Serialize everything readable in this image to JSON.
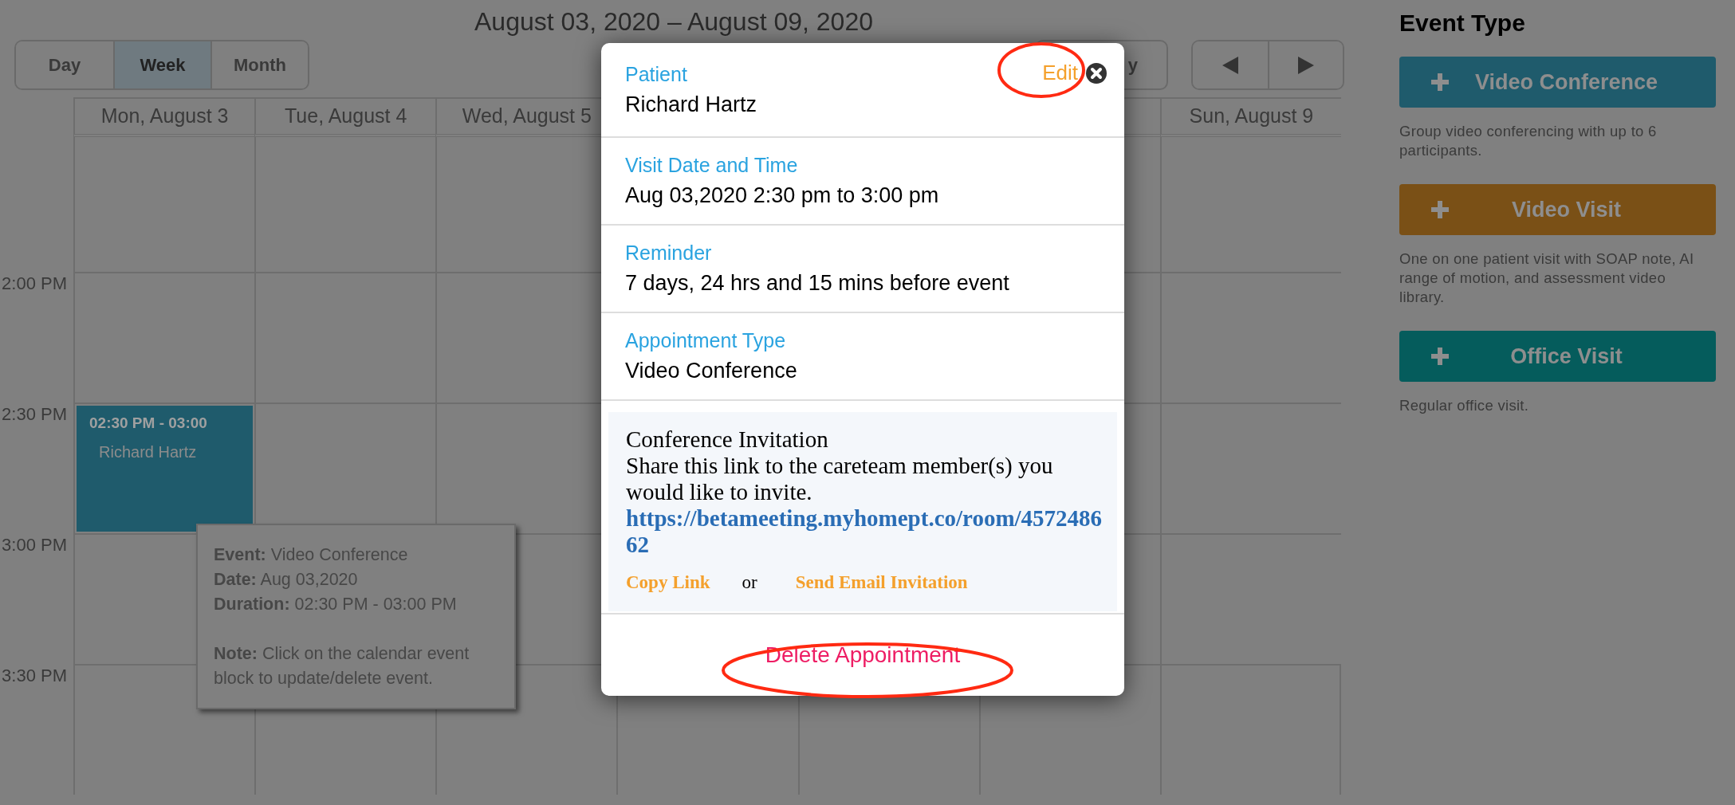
{
  "calendar": {
    "title": "August 03, 2020 – August 09, 2020",
    "views": [
      {
        "label": "Day",
        "selected": false
      },
      {
        "label": "Week",
        "selected": true
      },
      {
        "label": "Month",
        "selected": false
      }
    ],
    "nav_button": {
      "label": "y"
    },
    "day_headers_left": [
      "Mon, August 3",
      "Tue, August 4",
      "Wed, August 5"
    ],
    "day_headers_right": [
      "Sun, August 9"
    ],
    "time_slots": [
      "2:00 PM",
      "2:30 PM",
      "3:00 PM",
      "3:30 PM"
    ],
    "event": {
      "time": "02:30 PM - 03:00",
      "patient": "Richard Hartz"
    },
    "tooltip": {
      "lines": [
        "**Event:** Video Conference",
        "**Date:** Aug 03,2020",
        "**Duration:** 02:30 PM - 03:00 PM"
      ],
      "note": "**Note:** Click on the calendar event block to update/delete event."
    }
  },
  "event_types": {
    "title": "Event Type",
    "items": [
      {
        "label": "Video Conference",
        "description": "Group video conferencing with up to 6 participants.",
        "color": "#1f5b6c"
      },
      {
        "label": "Video Visit",
        "description": "One on one patient visit with SOAP note, AI range of motion, and assessment video library.",
        "color": "#7a5016"
      },
      {
        "label": "Office Visit",
        "description": "Regular office visit.",
        "color": "#055c5c"
      }
    ]
  },
  "modal": {
    "edit": "Edit",
    "fields": [
      {
        "label": "Patient",
        "value": "Richard Hartz"
      },
      {
        "label": "Visit Date and Time",
        "value": "Aug 03,2020 2:30 pm to 3:00 pm"
      },
      {
        "label": "Reminder",
        "value": "7 days, 24 hrs and 15 mins before event"
      },
      {
        "label": "Appointment Type",
        "value": "Video Conference"
      }
    ],
    "invitation": {
      "title": "Conference Invitation",
      "text": "Share this link to the careteam member(s) you would like to invite.",
      "link": "https://betameeting.myhomept.co/room/457248662",
      "copy_link": "Copy Link",
      "separator": "or",
      "email_link": "Send Email Invitation"
    },
    "delete": "Delete Appointment"
  }
}
